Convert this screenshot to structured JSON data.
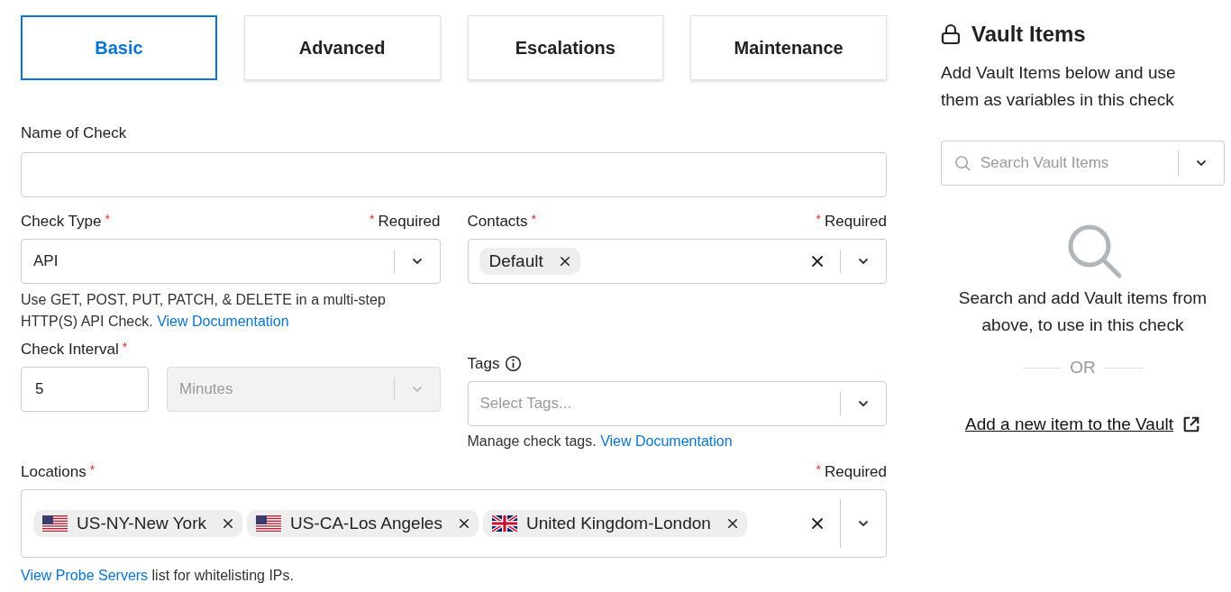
{
  "tabs": [
    {
      "label": "Basic",
      "selected": true
    },
    {
      "label": "Advanced",
      "selected": false
    },
    {
      "label": "Escalations",
      "selected": false
    },
    {
      "label": "Maintenance",
      "selected": false
    }
  ],
  "name_field": {
    "label": "Name of Check"
  },
  "check_type": {
    "label": "Check Type",
    "mark": "*",
    "note_mark": "*",
    "note": "Required",
    "value": "API",
    "help_text": "Use GET, POST, PUT, PATCH, & DELETE in a multi-step HTTP(S) API Check.",
    "help_link": "View Documentation"
  },
  "contacts": {
    "label": "Contacts",
    "mark": "*",
    "note_mark": "*",
    "note": "Required",
    "chips": [
      "Default"
    ]
  },
  "check_interval": {
    "label": "Check Interval",
    "mark": "*",
    "value": "5",
    "unit": "Minutes",
    "unit_disabled": true
  },
  "tags": {
    "label": "Tags",
    "placeholder": "Select Tags...",
    "help_text": "Manage check tags.",
    "help_link": "View Documentation"
  },
  "locations": {
    "label": "Locations",
    "mark": "*",
    "note_mark": "*",
    "note": "Required",
    "chips": [
      {
        "label": "US-NY-New York",
        "kind": "us"
      },
      {
        "label": "US-CA-Los Angeles",
        "kind": "us"
      },
      {
        "label": "United Kingdom-London",
        "kind": "uk"
      }
    ],
    "help_link": "View Probe Servers",
    "help_text": "list for whitelisting IPs."
  },
  "vault": {
    "title": "Vault Items",
    "description": "Add Vault Items below and use them as variables in this check",
    "search_placeholder": "Search Vault Items",
    "empty_text": "Search and add Vault items from above, to use in this check",
    "divider": "OR",
    "add_link": "Add a new item to the Vault"
  }
}
